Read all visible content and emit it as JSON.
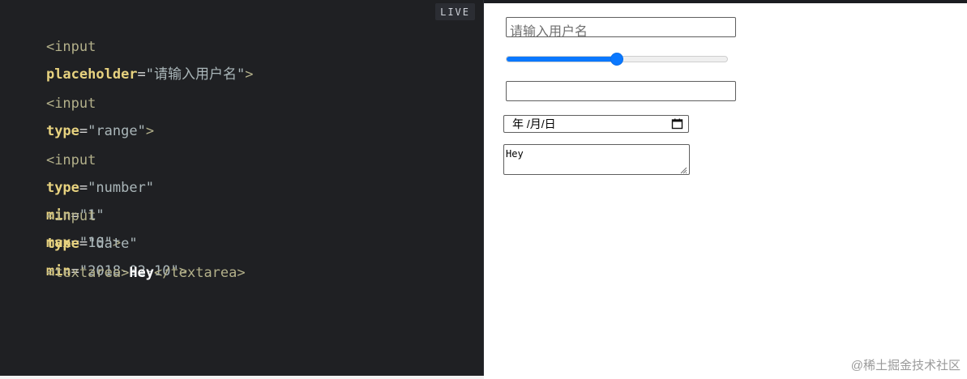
{
  "badges": {
    "live": "LIVE"
  },
  "editor": {
    "lines": [
      {
        "open": "<input",
        "attr1": "placeholder",
        "eq1": "=",
        "val1": "\"请输入用户名\"",
        "close": ">"
      },
      {
        "open": "<input",
        "attr1": "type",
        "eq1": "=",
        "val1": "\"range\"",
        "close": ">"
      },
      {
        "open": "<input",
        "attr1": "type",
        "eq1": "=",
        "val1": "\"number\"",
        "attr2": "min",
        "eq2": "=",
        "val2": "\"1\"",
        "attr3": "max",
        "eq3": "=",
        "val3": "\"10\"",
        "close": ">"
      },
      {
        "open": "<input",
        "attr1": "type",
        "eq1": "=",
        "val1": "\"date\"",
        "attr2": "min",
        "eq2": "=",
        "val2": "\"2018-02-10\"",
        "close": ">"
      },
      {
        "open": "<textarea>",
        "text": "Hey",
        "close": "</textarea>"
      }
    ]
  },
  "preview": {
    "text_input_placeholder": "请输入用户名",
    "range_value_fraction": 0.5,
    "date_placeholder": "年 /月/日",
    "textarea_value": "Hey"
  },
  "footer": {
    "watermark": "@稀土掘金技术社区"
  },
  "colors": {
    "editor_bg": "#1f2023",
    "tag": "#b3b08a",
    "attribute": "#e7d27f",
    "string": "#aab6b9",
    "range_accent": "#0a78ff",
    "watermark": "#9a9a9a"
  },
  "icons": {
    "calendar": "calendar-icon",
    "resize": "resize-handle-icon"
  }
}
